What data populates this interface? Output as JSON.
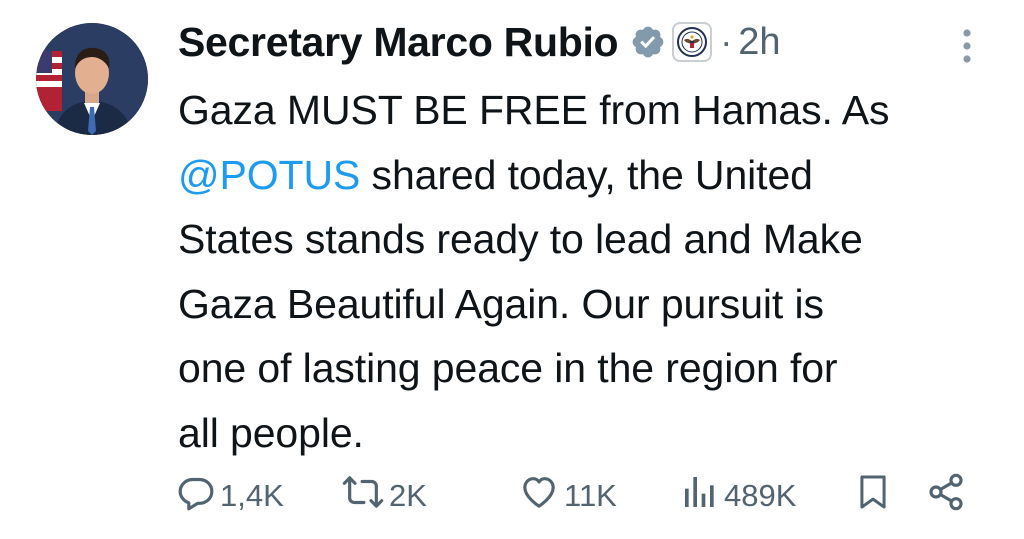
{
  "tweet": {
    "display_name": "Secretary Marco Rubio",
    "separator": "·",
    "timestamp": "2h",
    "text_before_mention": "Gaza MUST BE FREE from Hamas. As\n",
    "mention": "@POTUS",
    "text_after_mention": " shared today, the United\nStates stands ready to lead and Make\nGaza Beautiful Again. Our pursuit is\none of lasting peace in the region for\nall people."
  },
  "icons": {
    "verified": "verified-badge-icon",
    "affiliation": "state-department-seal-icon",
    "more": "more-options-icon",
    "reply": "reply-icon",
    "retweet": "retweet-icon",
    "like": "heart-icon",
    "views": "views-chart-icon",
    "bookmark": "bookmark-icon",
    "share": "share-icon"
  },
  "actions": {
    "replies": "1,4K",
    "reposts": "2K",
    "likes": "11K",
    "views": "489K"
  },
  "colors": {
    "text": "#0f1419",
    "secondary": "#536471",
    "link": "#1d9bf0",
    "verified_badge": "#829aab"
  }
}
